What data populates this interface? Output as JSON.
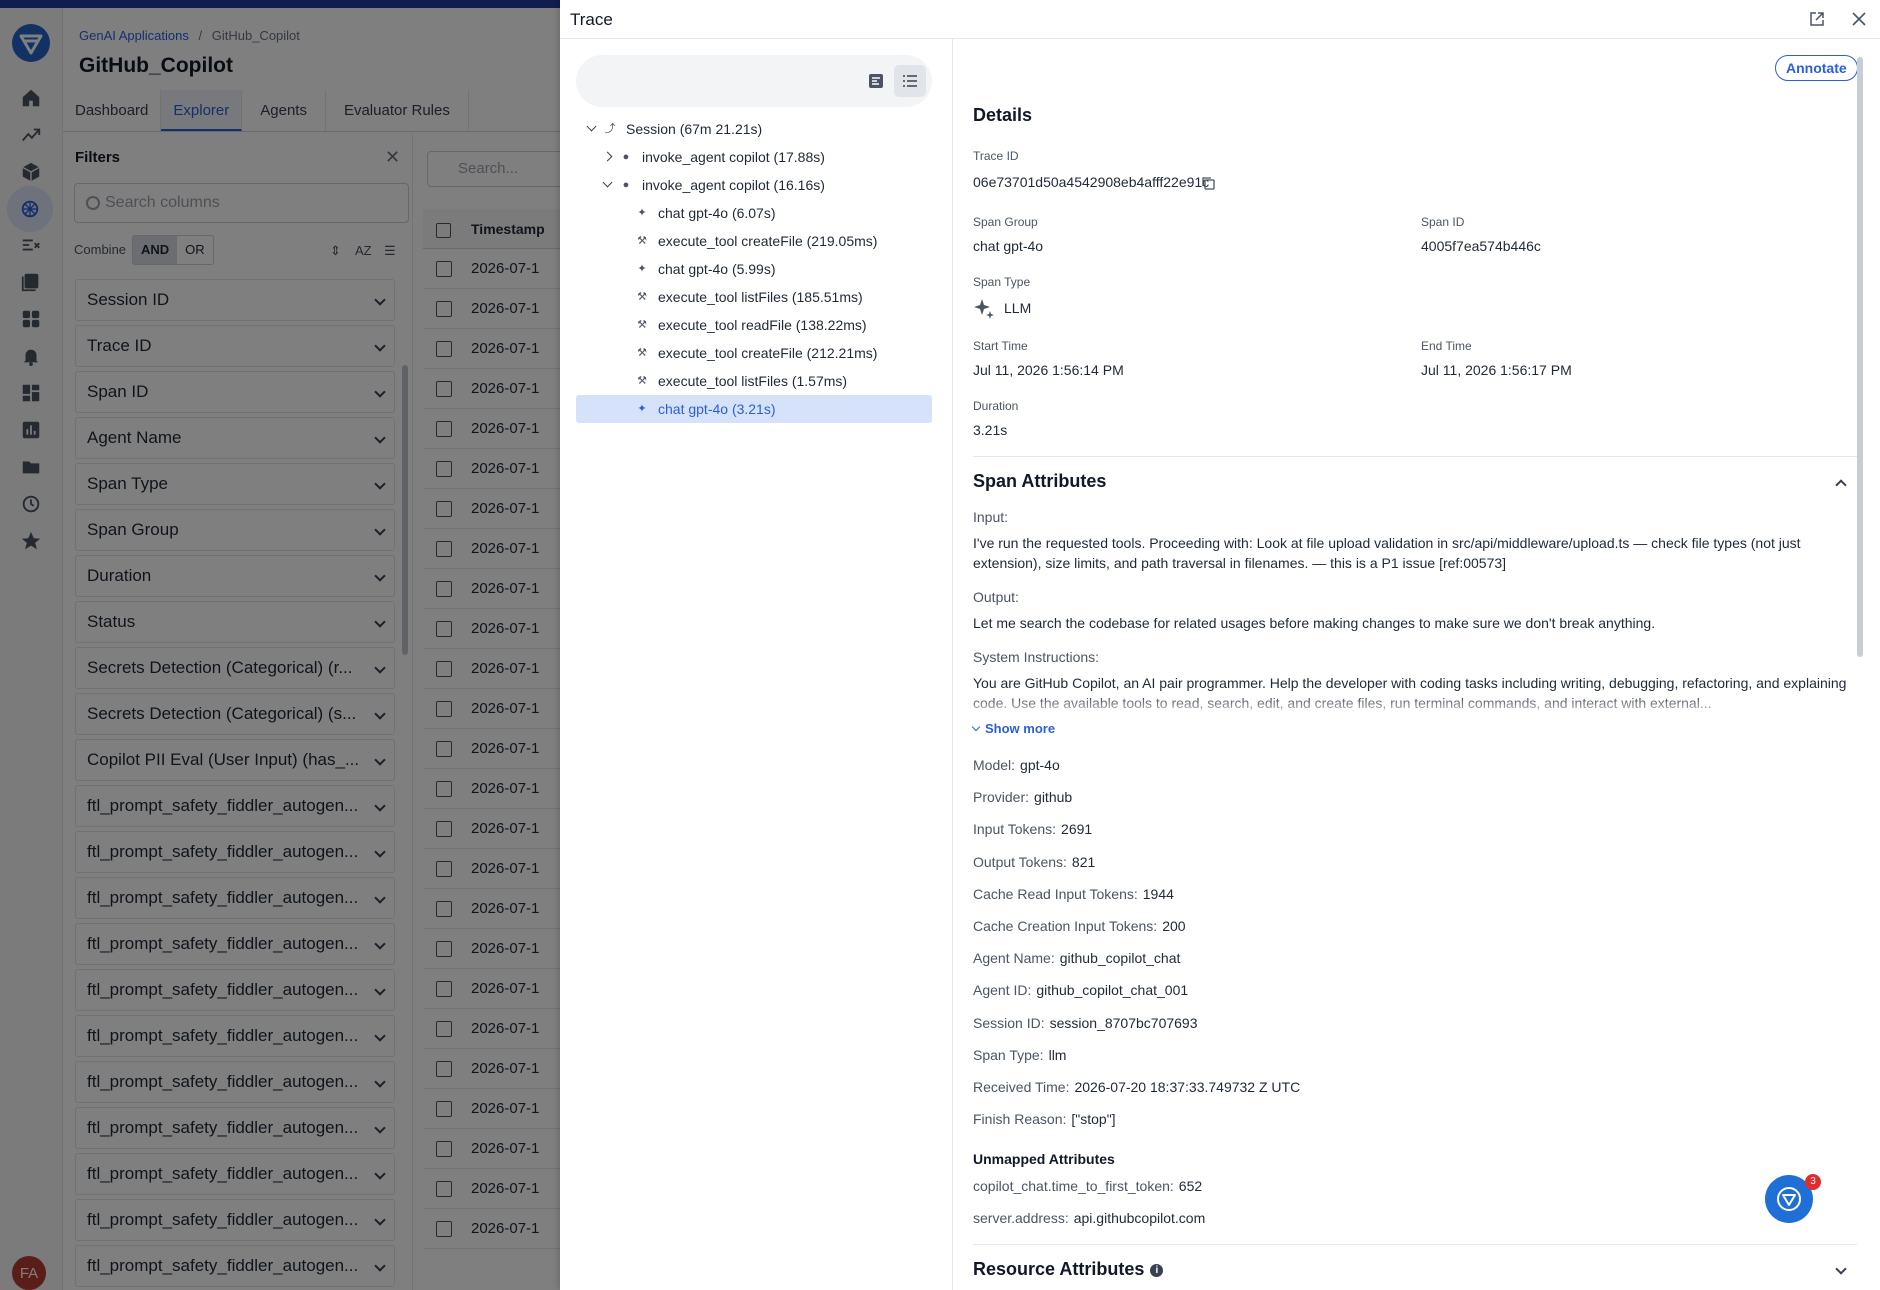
{
  "app": {
    "breadcrumb_root": "GenAI Applications",
    "breadcrumb_sep": "/",
    "breadcrumb_current": "GitHub_Copilot",
    "title": "GitHub_Copilot",
    "user_initials": "FA",
    "accent_color": "#2b5fd9"
  },
  "tabs": [
    "Dashboard",
    "Explorer",
    "Agents",
    "Evaluator Rules"
  ],
  "filters": {
    "title": "Filters",
    "search_placeholder": "Search columns",
    "combine_label": "Combine",
    "and_label": "AND",
    "or_label": "OR",
    "az_label": "AZ",
    "items": [
      "Session ID",
      "Trace ID",
      "Span ID",
      "Agent Name",
      "Span Type",
      "Span Group",
      "Duration",
      "Status",
      "Secrets Detection (Categorical) (r...",
      "Secrets Detection (Categorical) (s...",
      "Copilot PII Eval (User Input) (has_...",
      "ftl_prompt_safety_fiddler_autogen...",
      "ftl_prompt_safety_fiddler_autogen...",
      "ftl_prompt_safety_fiddler_autogen...",
      "ftl_prompt_safety_fiddler_autogen...",
      "ftl_prompt_safety_fiddler_autogen...",
      "ftl_prompt_safety_fiddler_autogen...",
      "ftl_prompt_safety_fiddler_autogen...",
      "ftl_prompt_safety_fiddler_autogen...",
      "ftl_prompt_safety_fiddler_autogen...",
      "ftl_prompt_safety_fiddler_autogen...",
      "ftl_prompt_safety_fiddler_autogen..."
    ]
  },
  "table": {
    "search_placeholder": "Search...",
    "timestamp_header": "Timestamp",
    "row_value": "2026-07-1",
    "row_count": 25
  },
  "trace": {
    "title": "Trace",
    "tree": [
      {
        "label": "Session (67m 21.21s)",
        "indent": 0,
        "arrow": "down",
        "icon": "session"
      },
      {
        "label": "invoke_agent copilot (17.88s)",
        "indent": 1,
        "arrow": "right",
        "icon": "agent"
      },
      {
        "label": "invoke_agent copilot (16.16s)",
        "indent": 1,
        "arrow": "down",
        "icon": "agent"
      },
      {
        "label": "chat gpt-4o (6.07s)",
        "indent": 2,
        "arrow": "",
        "icon": "llm"
      },
      {
        "label": "execute_tool createFile (219.05ms)",
        "indent": 2,
        "arrow": "",
        "icon": "tool"
      },
      {
        "label": "chat gpt-4o (5.99s)",
        "indent": 2,
        "arrow": "",
        "icon": "llm"
      },
      {
        "label": "execute_tool listFiles (185.51ms)",
        "indent": 2,
        "arrow": "",
        "icon": "tool"
      },
      {
        "label": "execute_tool readFile (138.22ms)",
        "indent": 2,
        "arrow": "",
        "icon": "tool"
      },
      {
        "label": "execute_tool createFile (212.21ms)",
        "indent": 2,
        "arrow": "",
        "icon": "tool"
      },
      {
        "label": "execute_tool listFiles (1.57ms)",
        "indent": 2,
        "arrow": "",
        "icon": "tool"
      },
      {
        "label": "chat gpt-4o (3.21s)",
        "indent": 2,
        "arrow": "",
        "icon": "llm",
        "selected": true
      }
    ],
    "annotate_label": "Annotate",
    "details": {
      "title": "Details",
      "trace_id_label": "Trace ID",
      "trace_id": "06e73701d50a4542908eb4afff22e91c",
      "span_group_label": "Span Group",
      "span_group": "chat gpt-4o",
      "span_id_label": "Span ID",
      "span_id": "4005f7ea574b446c",
      "span_type_label": "Span Type",
      "span_type": "LLM",
      "start_time_label": "Start Time",
      "start_time": "Jul 11, 2026 1:56:14 PM",
      "end_time_label": "End Time",
      "end_time": "Jul 11, 2026 1:56:17 PM",
      "duration_label": "Duration",
      "duration": "3.21s"
    },
    "span_attributes": {
      "title": "Span Attributes",
      "input_label": "Input:",
      "input": "I've run the requested tools. Proceeding with: Look at file upload validation in src/api/middleware/upload.ts — check file types (not just extension), size limits, and path traversal in filenames. — this is a P1 issue [ref:00573]",
      "output_label": "Output:",
      "output": "Let me search the codebase for related usages before making changes to make sure we don't break anything.",
      "system_label": "System Instructions:",
      "system": "You are GitHub Copilot, an AI pair programmer. Help the developer with coding tasks including writing, debugging, refactoring, and explaining code. Use the available tools to read, search, edit, and create files, run terminal commands, and interact with external...",
      "show_more": "Show more",
      "fields": [
        {
          "k": "Model:",
          "v": "gpt-4o"
        },
        {
          "k": "Provider:",
          "v": "github"
        },
        {
          "k": "Input Tokens:",
          "v": "2691"
        },
        {
          "k": "Output Tokens:",
          "v": "821"
        },
        {
          "k": "Cache Read Input Tokens:",
          "v": "1944"
        },
        {
          "k": "Cache Creation Input Tokens:",
          "v": "200"
        },
        {
          "k": "Agent Name:",
          "v": "github_copilot_chat"
        },
        {
          "k": "Agent ID:",
          "v": "github_copilot_chat_001"
        },
        {
          "k": "Session ID:",
          "v": "session_8707bc707693"
        },
        {
          "k": "Span Type:",
          "v": "llm"
        },
        {
          "k": "Received Time:",
          "v": "2026-07-20 18:37:33.749732 Z UTC"
        },
        {
          "k": "Finish Reason:",
          "v": "[\"stop\"]"
        }
      ],
      "unmapped_title": "Unmapped Attributes",
      "unmapped": [
        {
          "k": "copilot_chat.time_to_first_token:",
          "v": "652"
        },
        {
          "k": "server.address:",
          "v": "api.githubcopilot.com"
        }
      ]
    },
    "resource_attributes_title": "Resource Attributes",
    "help_badge_count": "3"
  }
}
